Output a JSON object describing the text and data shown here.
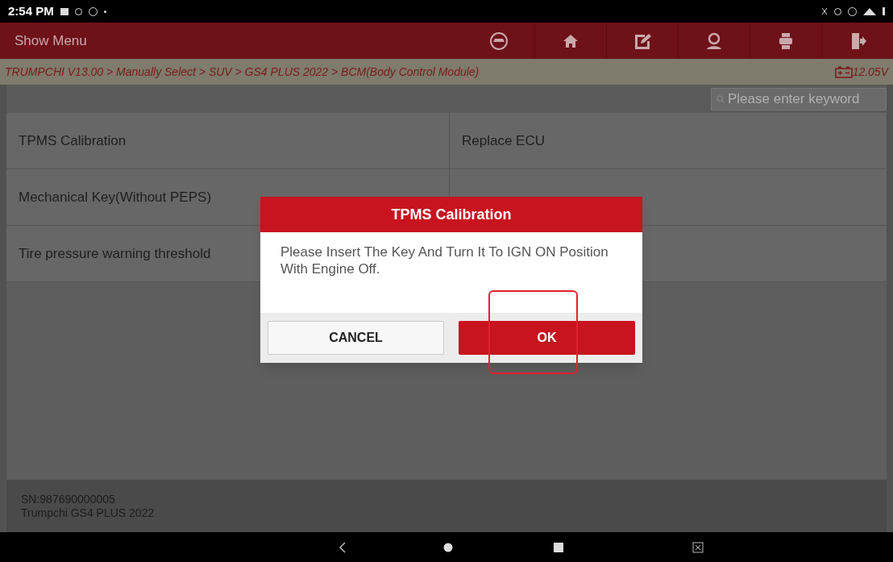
{
  "status_bar": {
    "time": "2:54 PM"
  },
  "header": {
    "menu_label": "Show Menu",
    "toolbar": [
      {
        "kind": "car"
      },
      {
        "kind": "home"
      },
      {
        "kind": "edit"
      },
      {
        "kind": "user"
      },
      {
        "kind": "print"
      },
      {
        "kind": "exit"
      }
    ]
  },
  "breadcrumb": {
    "path": "TRUMPCHI V13.00 > Manually Select > SUV > GS4 PLUS 2022 > BCM(Body Control Module)",
    "voltage": "12.05V"
  },
  "search": {
    "placeholder": "Please enter keyword"
  },
  "function_rows": [
    {
      "left": "TPMS Calibration",
      "right": "Replace ECU"
    },
    {
      "left": "Mechanical Key(Without PEPS)"
    },
    {
      "left": "Tire pressure warning threshold"
    }
  ],
  "footer": {
    "serial": "SN:987690000005",
    "vehicle": "Trumpchi GS4 PLUS 2022"
  },
  "dialog": {
    "title": "TPMS Calibration",
    "message": "Please Insert The Key And Turn It To IGN ON Position With Engine Off.",
    "buttons": [
      {
        "label": "CANCEL",
        "kind": "secondary"
      },
      {
        "label": "OK",
        "kind": "primary"
      }
    ]
  }
}
